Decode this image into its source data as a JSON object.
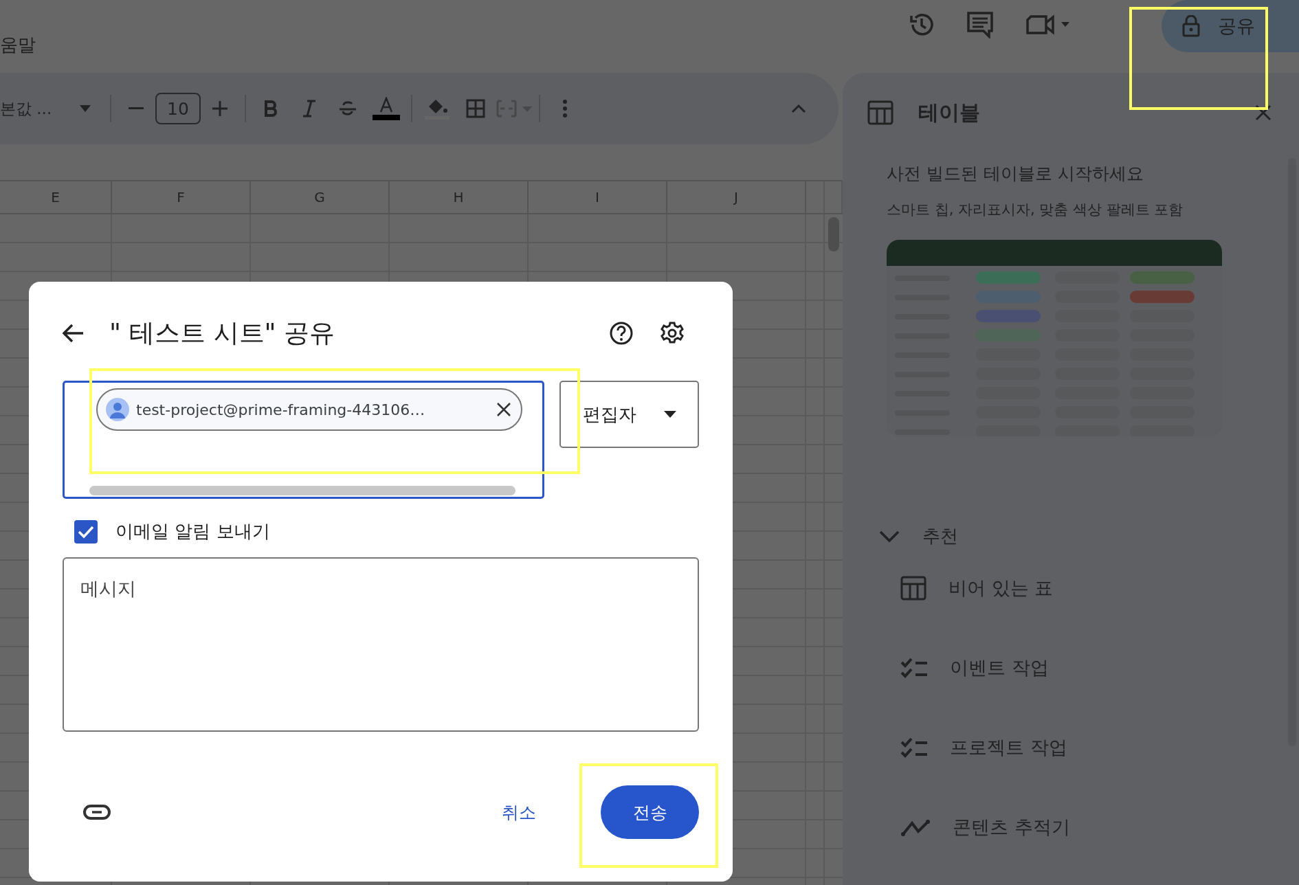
{
  "app_bar": {
    "menu_label": "움말",
    "share_button": {
      "label": "공유"
    }
  },
  "toolbar": {
    "font_name": "본값 ...",
    "font_size": "10"
  },
  "sheet": {
    "columns": [
      "E",
      "F",
      "G",
      "H",
      "I",
      "J"
    ]
  },
  "side_panel": {
    "title": "테이블",
    "heading": "사전 빌드된 테이블로 시작하세요",
    "subtitle": "스마트 칩, 자리표시자, 맞춤 색상 팔레트 포함",
    "section": {
      "title": "추천",
      "expanded": true
    },
    "items": [
      {
        "kind": "table",
        "label": "비어 있는 표"
      },
      {
        "kind": "checklist",
        "label": "이벤트 작업"
      },
      {
        "kind": "checklist",
        "label": "프로젝트 작업"
      },
      {
        "kind": "trend",
        "label": "콘텐츠 추적기"
      }
    ]
  },
  "dialog": {
    "title": "\" 테스트 시트\" 공유",
    "recipient_chip": "test-project@prime-framing-443106…",
    "role": "편집자",
    "notify": {
      "label": "이메일 알림 보내기",
      "checked": true
    },
    "message": {
      "placeholder": "메시지"
    },
    "cancel": "취소",
    "send": "전송"
  }
}
